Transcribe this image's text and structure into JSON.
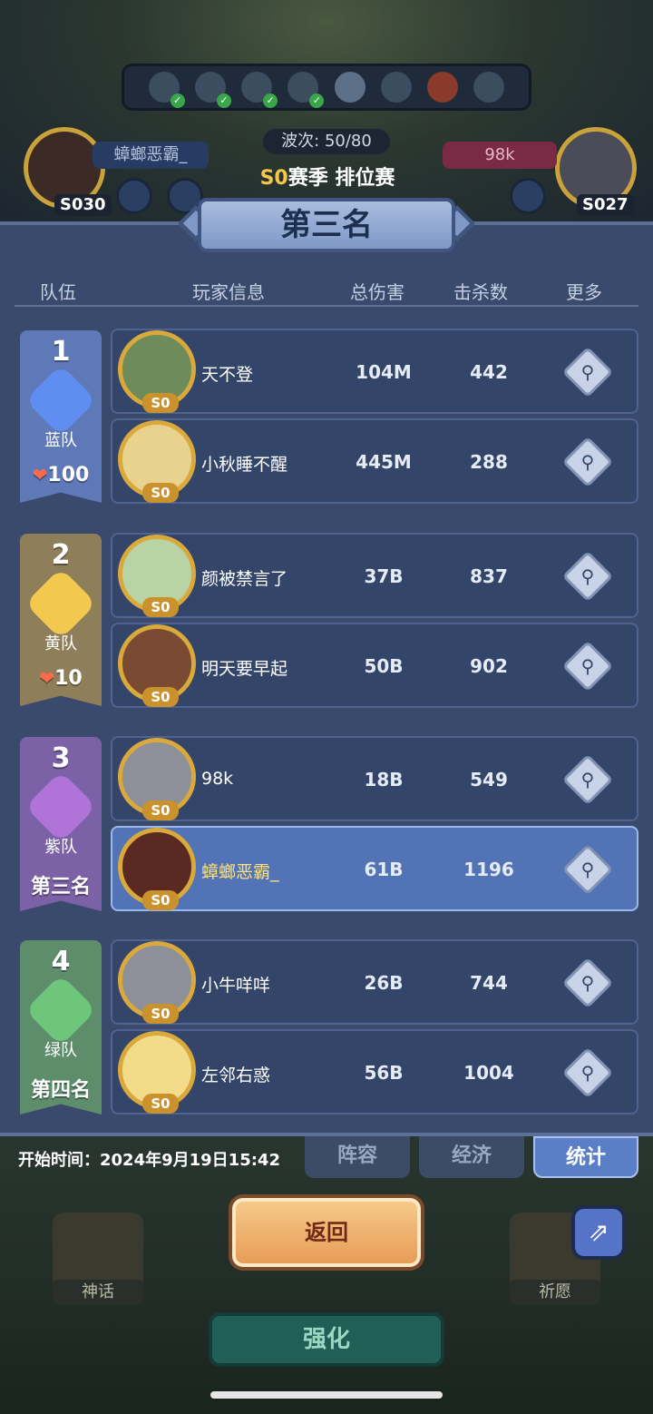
{
  "hud": {
    "wave": "波次: 50/80",
    "season_prefix": "S0",
    "season_title": "赛季 排位赛",
    "left_player_name": "蟑螂恶霸_",
    "right_player_name": "98k",
    "left_level": "S030",
    "right_level": "S027"
  },
  "result_title": "第三名",
  "table_header": {
    "team": "队伍",
    "player_info": "玩家信息",
    "total_damage": "总伤害",
    "kills": "击杀数",
    "more": "更多"
  },
  "avatar_tag": "S0",
  "more_icon": "magnifier-icon",
  "teams": [
    {
      "rank": "1",
      "name": "蓝队",
      "hearts": "100",
      "placement": "",
      "colors": {
        "flag": "#5e78b8",
        "emblem": "#5d8ef0"
      },
      "players": [
        {
          "name": "天不登",
          "damage": "104M",
          "kills": "442"
        },
        {
          "name": "小秋睡不醒",
          "damage": "445M",
          "kills": "288"
        }
      ]
    },
    {
      "rank": "2",
      "name": "黄队",
      "hearts": "10",
      "placement": "",
      "colors": {
        "flag": "#8e7f5a",
        "emblem": "#f3c84f"
      },
      "players": [
        {
          "name": "颜被禁言了",
          "damage": "37B",
          "kills": "837"
        },
        {
          "name": "明天要早起",
          "damage": "50B",
          "kills": "902"
        }
      ]
    },
    {
      "rank": "3",
      "name": "紫队",
      "hearts": "",
      "placement": "第三名",
      "colors": {
        "flag": "#7b62a6",
        "emblem": "#b073d8"
      },
      "players": [
        {
          "name": "98k",
          "damage": "18B",
          "kills": "549"
        },
        {
          "name": "蟑螂恶霸_",
          "damage": "61B",
          "kills": "1196"
        }
      ]
    },
    {
      "rank": "4",
      "name": "绿队",
      "hearts": "",
      "placement": "第四名",
      "colors": {
        "flag": "#5e8d6c",
        "emblem": "#6ec67a"
      },
      "players": [
        {
          "name": "小牛咩咩",
          "damage": "26B",
          "kills": "744"
        },
        {
          "name": "左邻右惑",
          "damage": "56B",
          "kills": "1004"
        }
      ]
    }
  ],
  "footer": {
    "start_time": "开始时间：2024年9月19日15:42",
    "tabs": [
      "阵容",
      "经济",
      "统计"
    ],
    "return_label": "返回",
    "left_side_label": "神话",
    "right_side_label": "祈愿",
    "enhance_label": "强化"
  }
}
